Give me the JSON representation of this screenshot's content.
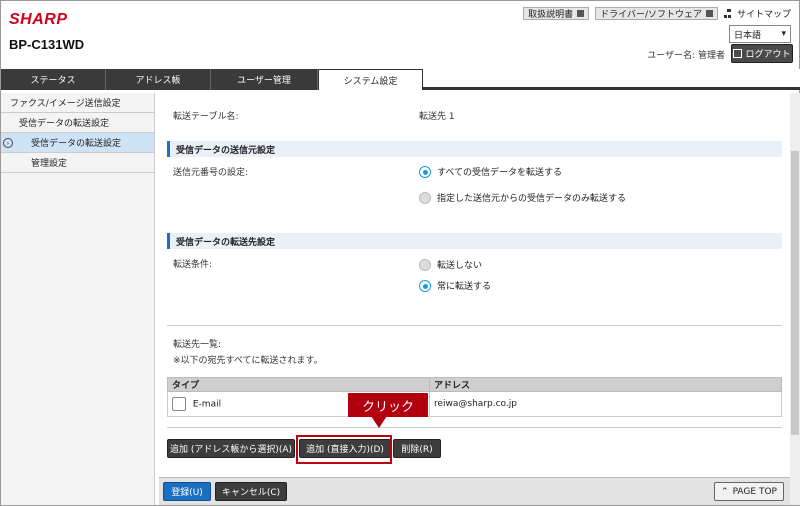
{
  "header": {
    "brand": "SHARP",
    "model": "BP-C131WD",
    "links": [
      {
        "label": "取扱説明書"
      },
      {
        "label": "ドライバー/ソフトウェア"
      }
    ],
    "sitemap_label": "サイトマップ",
    "language": {
      "selected": "日本語"
    },
    "user_line": "ユーザー名: 管理者",
    "logout_label": "ログアウト"
  },
  "tabs": [
    {
      "label": "ステータス"
    },
    {
      "label": "アドレス帳"
    },
    {
      "label": "ユーザー管理"
    },
    {
      "label": "システム設定",
      "active": true
    }
  ],
  "sidebar": {
    "items": [
      {
        "label": "ファクス/イメージ送信設定"
      },
      {
        "label": "受信データの転送設定"
      },
      {
        "label": "受信データの転送設定",
        "active": true
      },
      {
        "label": "管理設定"
      }
    ]
  },
  "main": {
    "table_name_label": "転送テーブル名:",
    "table_name_value": "転送先 1",
    "source_section": {
      "title": "受信データの送信元設定",
      "field_label": "送信元番号の設定:",
      "options": [
        {
          "label": "すべての受信データを転送する",
          "selected": true
        },
        {
          "label": "指定した送信元からの受信データのみ転送する",
          "selected": false
        }
      ]
    },
    "dest_section": {
      "title": "受信データの転送先設定",
      "field_label": "転送条件:",
      "options": [
        {
          "label": "転送しない",
          "selected": false
        },
        {
          "label": "常に転送する",
          "selected": true
        }
      ]
    },
    "dest_list": {
      "label": "転送先一覧:",
      "note": "※以下の宛先すべてに転送されます。",
      "columns": [
        "タイプ",
        "アドレス"
      ],
      "rows": [
        {
          "type": "E-mail",
          "address": "reiwa@sharp.co.jp"
        }
      ]
    },
    "buttons": {
      "add_from_book": "追加 (アドレス帳から選択)(A)",
      "add_direct": "追加 (直接入力)(D)",
      "delete": "削除(R)"
    },
    "callout": "クリック"
  },
  "footer": {
    "register": "登録(U)",
    "cancel": "キャンセル(C)",
    "page_top": "PAGE TOP"
  },
  "colors": {
    "accent": "#1b6fc2",
    "radio_on": "#1a9bd7",
    "highlight": "#c0000f"
  }
}
